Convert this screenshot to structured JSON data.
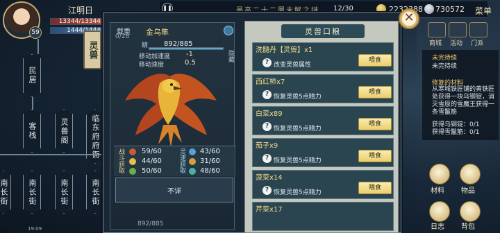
{
  "player": {
    "name": "江明日",
    "level": "59",
    "hp": "13344/13344",
    "mp": "1444/1444"
  },
  "top_bar": {
    "pause_icon": "pause-icon",
    "title": "最高二十二層未解之謎",
    "count": "12/30",
    "gold": "2232388",
    "silver": "730572",
    "menu_label": "菜单"
  },
  "map": {
    "nodes": [
      "民居",
      "客栈",
      "灵兽阁",
      "临东府府衙",
      "南长街",
      "南长街",
      "南长街",
      "南长街"
    ]
  },
  "left_panel": {
    "tab_label": "灵兽",
    "weight_label": "载重",
    "weight_value": "0/28",
    "beast_name": "金乌隼",
    "vigor_value": "892/885",
    "vigor_fraction": 1.0,
    "move_add_label": "移动加速度",
    "move_add_value": "-1",
    "move_speed_label": "移动速度",
    "move_speed_value": "0.5",
    "side_mode": "隐藏",
    "battle_label": "战斗获取",
    "rare_label": "灵速获取",
    "stats_left": [
      "59/60",
      "44/60",
      "50/60"
    ],
    "stats_right": [
      "43/60",
      "31/60",
      "48/60"
    ],
    "unknown_button": "不详",
    "bottom_hp": "892/885"
  },
  "feed_panel": {
    "title": "灵兽口粮",
    "items": [
      {
        "name": "洗髓丹【灵兽】x1",
        "desc": "改变灵兽属性",
        "button": "喂食"
      },
      {
        "name": "西红柿x7",
        "desc": "恢复灵兽5点精力",
        "button": "喂食"
      },
      {
        "name": "白菜x89",
        "desc": "恢复灵兽5点精力",
        "button": "喂食"
      },
      {
        "name": "茄子x9",
        "desc": "恢复灵兽5点精力",
        "button": "喂食"
      },
      {
        "name": "菠菜x14",
        "desc": "恢复灵兽5点精力",
        "button": "喂食"
      },
      {
        "name": "芹菜x17",
        "desc": "",
        "button": ""
      }
    ]
  },
  "hud": {
    "icons": [
      {
        "name": "商城",
        "icon": "shop-icon"
      },
      {
        "name": "活动",
        "icon": "activity-icon"
      },
      {
        "name": "门派",
        "icon": "sect-icon"
      },
      {
        "name": "材料",
        "icon": "material-icon"
      },
      {
        "name": "物品",
        "icon": "item-icon"
      },
      {
        "name": "日志",
        "icon": "journal-icon"
      },
      {
        "name": "背包",
        "icon": "bag-icon"
      }
    ],
    "quest_unfinished_title": "未完待续",
    "quest_unfinished_desc": "未完待续",
    "quest_repair_title": "修复的材料",
    "quest_repair_desc": "从寒城铁匠铺的黄铁匠处获得一块乌钢锭，消灭雪原的雪魔王获得一条雪鬣筋",
    "quest_progress_1": "获得乌钢锭：0/1",
    "quest_progress_2": "获得雪鬣筋：0/1",
    "close_label": "✕"
  },
  "status_time": "19:09"
}
